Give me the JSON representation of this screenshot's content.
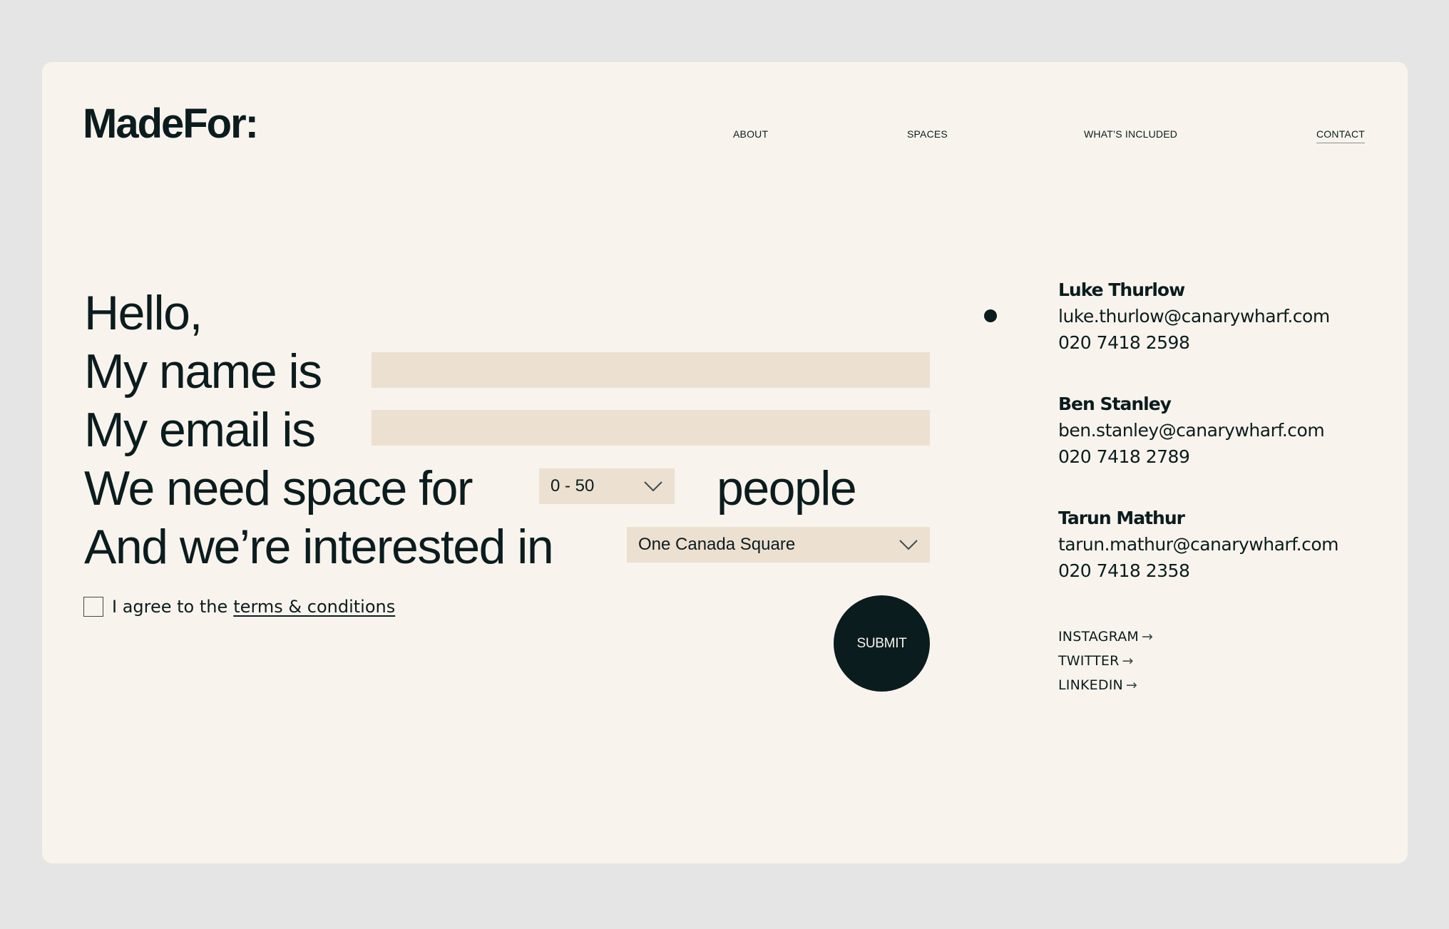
{
  "brand": {
    "logo": "MadeFor:"
  },
  "nav": {
    "items": [
      {
        "label": "ABOUT"
      },
      {
        "label": "SPACES"
      },
      {
        "label": "WHAT’S INCLUDED"
      },
      {
        "label": "CONTACT",
        "active": true
      }
    ]
  },
  "form": {
    "greeting": "Hello,",
    "name_label": "My name is",
    "name_value": "",
    "email_label": "My email is",
    "email_value": "",
    "space_label": "We need space for",
    "people_select": {
      "selected": "0 - 50"
    },
    "people_suffix": "people",
    "interest_label": "And we’re interested in",
    "location_select": {
      "selected": "One Canada Square"
    },
    "agree_text": "I agree to the",
    "terms_link": "terms & conditions",
    "agree_checked": false,
    "submit_label": "SUBMIT"
  },
  "contacts": [
    {
      "name": "Luke Thurlow",
      "email": "luke.thurlow@canarywharf.com",
      "phone": "020 7418 2598"
    },
    {
      "name": "Ben Stanley",
      "email": "ben.stanley@canarywharf.com",
      "phone": "020 7418 2789"
    },
    {
      "name": "Tarun Mathur",
      "email": "tarun.mathur@canarywharf.com",
      "phone": "020 7418 2358"
    }
  ],
  "social": [
    {
      "label": "INSTAGRAM",
      "icon": "arrow-right-icon",
      "glyph": "→"
    },
    {
      "label": "TWITTER",
      "icon": "arrow-right-icon",
      "glyph": "→"
    },
    {
      "label": "LINKEDIN",
      "icon": "arrow-right-icon",
      "glyph": "→"
    }
  ],
  "colors": {
    "page_bg": "#e5e5e5",
    "card_bg": "#f8f4ed",
    "field_bg": "#ece0d1",
    "ink": "#0b1c1e"
  }
}
